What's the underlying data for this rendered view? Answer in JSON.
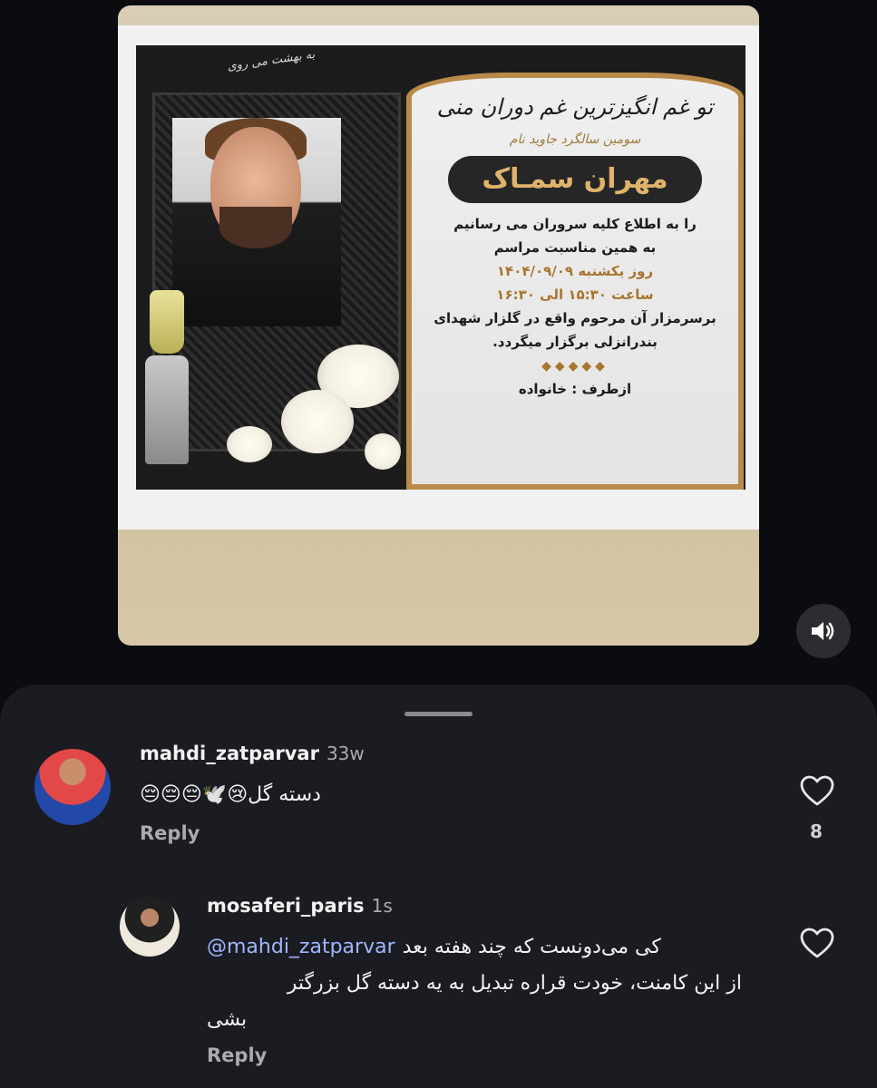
{
  "post": {
    "calligraphy": "به بهشت می روی",
    "title": "تو غم انگیزترین غم دوران منی",
    "subtitle": "سومین سالگرد جاوید نام",
    "name": "مهران سمـاک",
    "line1": "را به اطلاع کلیه سروران می رسانیم",
    "line2": "به همین مناسبت مراسم",
    "line3": "روز یکشنبه ۱۴۰۴/۰۹/۰۹",
    "line4": "ساعت ۱۵:۳۰ الی ۱۶:۳۰",
    "line5": "برسرمزار آن مرحوم واقع در گلزار شهدای",
    "line6": "بندرانزلی برگزار میگردد.",
    "ornament": "◆◆◆◆◆",
    "footer": "ازطرف : خانواده"
  },
  "audio_icon": "speaker-on-icon",
  "comments": [
    {
      "username": "mahdi_zatparvar",
      "time": "33w",
      "text": "دسته گل😢🕊️😔😔😔",
      "reply_label": "Reply",
      "likes": "8"
    },
    {
      "username": "mosaferi_paris",
      "time": "1s",
      "mention": "@mahdi_zatparvar",
      "text_line1": "کی می‌دونست که چند هفته بعد",
      "text_line2": "از این کامنت، خودت قراره تبدیل به یه دسته گل بزرگتر",
      "text_line3": "بشی",
      "reply_label": "Reply"
    }
  ]
}
